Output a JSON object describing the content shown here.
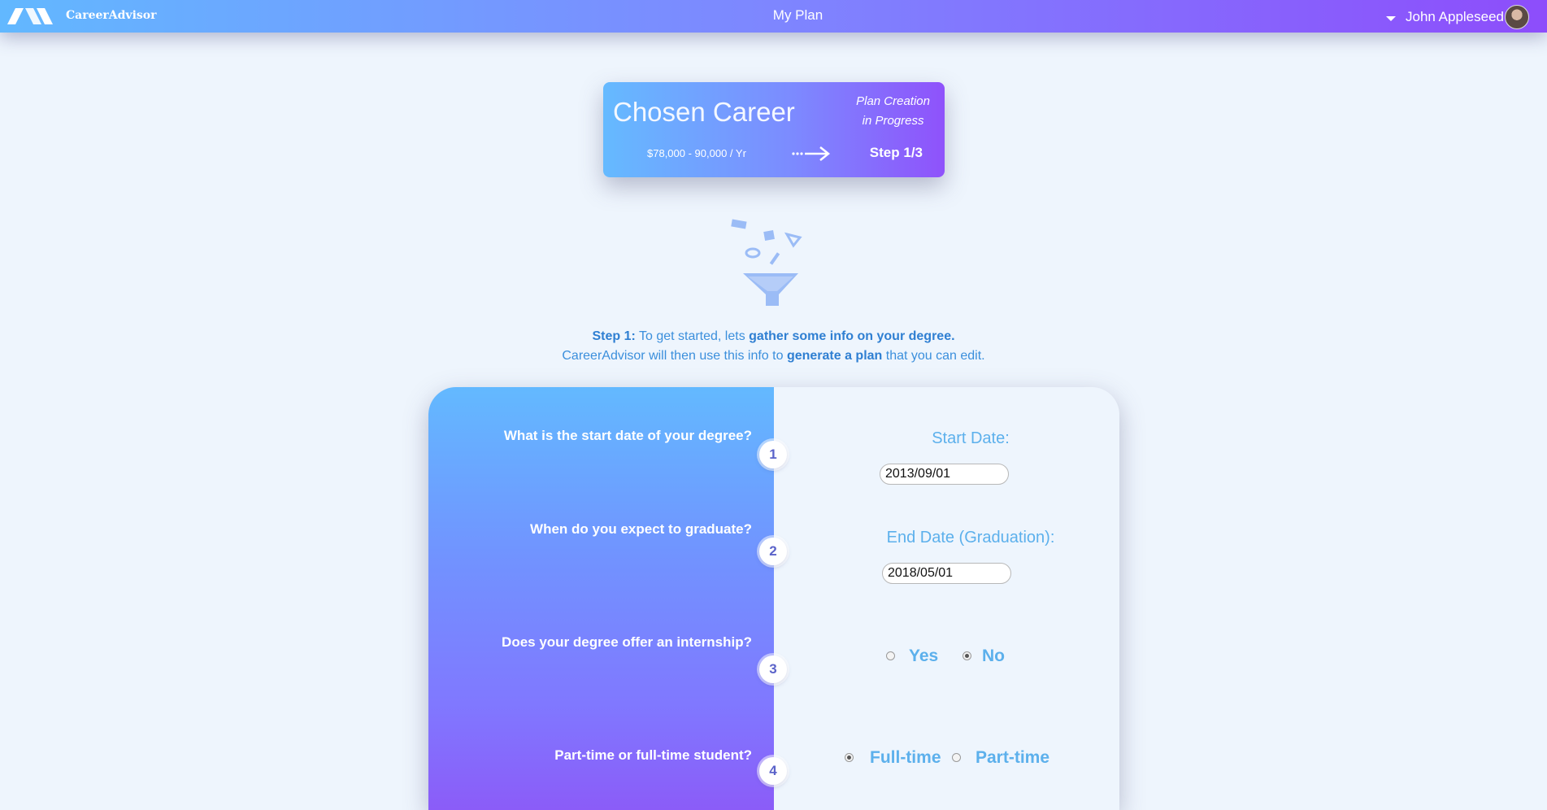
{
  "header": {
    "brand": "CareerAdvisor",
    "title": "My Plan",
    "user_name": "John Appleseed"
  },
  "career_card": {
    "title": "Chosen Career",
    "salary": "$78,000 - 90,000 / Yr",
    "status_line1": "Plan Creation",
    "status_line2": "in Progress",
    "step": "Step 1/3"
  },
  "intro": {
    "step_label": "Step 1:",
    "line1_a": " To get started, lets ",
    "line1_b": "gather some info on your degree.",
    "line2_a": "CareerAdvisor will then use this info to ",
    "line2_b": "generate a plan",
    "line2_c": " that you can edit."
  },
  "form": {
    "questions": [
      {
        "number": "1",
        "text": "What is the start date of your degree?"
      },
      {
        "number": "2",
        "text": "When do you expect to graduate?"
      },
      {
        "number": "3",
        "text": "Does your degree offer an internship?"
      },
      {
        "number": "4",
        "text": "Part-time or full-time student?"
      }
    ],
    "start_date_label": "Start Date:",
    "start_date_value": "2013/09/01",
    "end_date_label": "End Date (Graduation):",
    "end_date_value": "2018/05/01",
    "internship_yes": "Yes",
    "internship_no": "No",
    "internship_selected": "No",
    "study_full": "Full-time",
    "study_part": "Part-time",
    "study_selected": "Full-time"
  },
  "colors": {
    "gradient_start": "#62b8ff",
    "gradient_end": "#8d4dfb",
    "accent_text": "#3b8fdc",
    "page_bg": "#eef5fd"
  },
  "icons": [
    "logo-icon",
    "caret-down-icon",
    "avatar",
    "dotted-arrow-icon",
    "funnel-icon"
  ]
}
